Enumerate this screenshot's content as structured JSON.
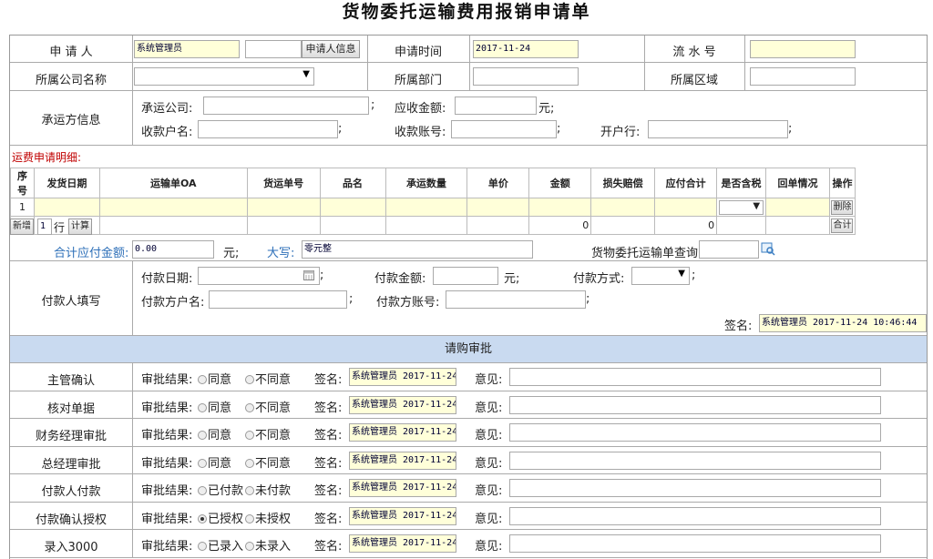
{
  "title": "货物委托运输费用报销申请单",
  "header": {
    "applicant_label": "申 请 人",
    "applicant_value": "系统管理员",
    "applicant_info_btn": "申请人信息",
    "apply_time_label": "申请时间",
    "apply_time_value": "2017-11-24",
    "serial_label": "流 水 号",
    "company_label": "所属公司名称",
    "department_label": "所属部门",
    "region_label": "所属区域"
  },
  "carrier": {
    "section_label": "承运方信息",
    "carrier_company_label": "承运公司:",
    "receivable_label": "应收金额:",
    "yuan": "元;",
    "payee_name_label": "收款户名:",
    "payee_account_label": "收款账号:",
    "bank_label": "开户行:",
    "semicolon": ";"
  },
  "detail": {
    "heading": "运费申请明细:",
    "columns": [
      "序号",
      "发货日期",
      "运输单OA",
      "货运单号",
      "品名",
      "承运数量",
      "单价",
      "金额",
      "损失赔偿",
      "应付合计",
      "是否含税",
      "回单情况",
      "操作"
    ],
    "row1_no": "1",
    "delete_btn": "删除",
    "total_btn": "合计",
    "total_amount": "0",
    "total_payable": "0",
    "add_btn": "新增",
    "add_count": "1",
    "row_unit": "行",
    "calc_btn": "计算",
    "sum_label": "合计应付金额:",
    "sum_value": "0.00",
    "sum_unit": "元;",
    "capital_label": "大写:",
    "capital_value": "零元整",
    "waybill_query_label": "货物委托运输单查询:"
  },
  "payer": {
    "section_label": "付款人填写",
    "pay_date_label": "付款日期:",
    "pay_amount_label": "付款金额:",
    "pay_method_label": "付款方式:",
    "payer_name_label": "付款方户名:",
    "payer_account_label": "付款方账号:",
    "sign_label": "签名:",
    "sign_value": "系统管理员 2017-11-24 10:46:44",
    "yuan": "元;",
    "semicolon": ";"
  },
  "approval": {
    "bar_label": "请购审批",
    "result_label": "审批结果:",
    "sign_label": "签名:",
    "opinion_label": "意见:",
    "rows": [
      {
        "name": "主管确认",
        "opt1": "同意",
        "opt2": "不同意",
        "sign": "系统管理员 2017-11-24"
      },
      {
        "name": "核对单据",
        "opt1": "同意",
        "opt2": "不同意",
        "sign": "系统管理员 2017-11-24"
      },
      {
        "name": "财务经理审批",
        "opt1": "同意",
        "opt2": "不同意",
        "sign": "系统管理员 2017-11-24"
      },
      {
        "name": "总经理审批",
        "opt1": "同意",
        "opt2": "不同意",
        "sign": "系统管理员 2017-11-24"
      },
      {
        "name": "付款人付款",
        "opt1": "已付款",
        "opt2": "未付款",
        "sign": "系统管理员 2017-11-24"
      },
      {
        "name": "付款确认授权",
        "opt1": "已授权",
        "opt2": "未授权",
        "sign": "系统管理员 2017-11-24"
      },
      {
        "name": "录入3000",
        "opt1": "已录入",
        "opt2": "未录入",
        "sign": "系统管理员 2017-11-24"
      }
    ]
  },
  "colors": {
    "highlight_bg": "#ffffd9",
    "approval_bar": "#c9daf0",
    "detail_heading": "#c00000",
    "sum_label": "#2d6fb8"
  }
}
